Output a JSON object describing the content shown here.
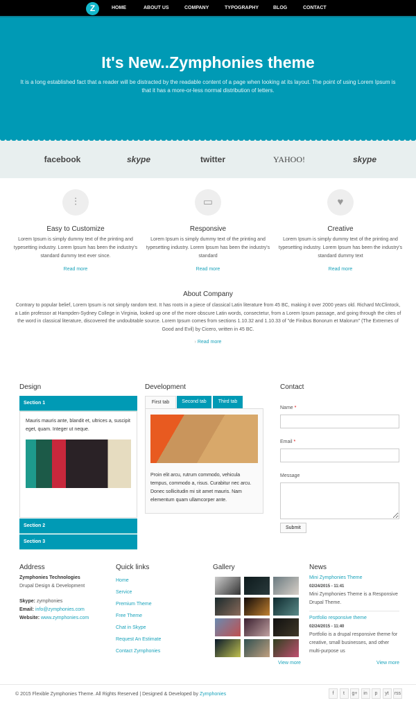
{
  "nav": {
    "logo": "Z",
    "items": [
      "HOME",
      "ABOUT US",
      "COMPANY",
      "TYPOGRAPHY",
      "BLOG",
      "CONTACT"
    ]
  },
  "hero": {
    "title": "It's New..Zymphonies theme",
    "text": "It is a long established fact that a reader will be distracted by the readable content of a page when looking at its layout. The point of using Lorem Ipsum is that it has a more-or-less normal distribution of letters."
  },
  "brands": [
    "facebook",
    "skype",
    "twitter",
    "YAHOO!",
    "skype"
  ],
  "features": [
    {
      "icon": "sliders-icon",
      "title": "Easy to Customize",
      "text": "Lorem Ipsum is simply dummy text of the printing and typesetting industry. Lorem Ipsum has been the industry's standard dummy text ever since.",
      "link": "Read more"
    },
    {
      "icon": "monitor-icon",
      "title": "Responsive",
      "text": "Lorem Ipsum is simply dummy text of the printing and typesetting industry. Lorem Ipsum has been the industry's standard",
      "link": "Read more"
    },
    {
      "icon": "heart-icon",
      "title": "Creative",
      "text": "Lorem Ipsum is simply dummy text of the printing and typesetting industry. Lorem Ipsum has been the industry's standard dummy text",
      "link": "Read more"
    }
  ],
  "about": {
    "title": "About Company",
    "text": "Contrary to popular belief, Lorem Ipsum is not simply random text. It has roots in a piece of classical Latin literature from 45 BC, making it over 2000 years old. Richard McClintock, a Latin professor at Hampden-Sydney College in Virginia, looked up one of the more obscure Latin words, consectetur, from a Lorem Ipsum passage, and going through the cites of the word in classical literature, discovered the undoubtable source. Lorem Ipsum comes from sections 1.10.32 and 1.10.33 of \"de Finibus Bonorum et Malorum\" (The Extremes of Good and Evil) by Cicero, written in 45 BC.",
    "link": "Read more"
  },
  "design": {
    "title": "Design",
    "sections": [
      "Section 1",
      "Section 2",
      "Section 3"
    ],
    "text": "Mauris mauris ante, blandit et, ultrices a, suscipit eget, quam. Integer ut neque."
  },
  "development": {
    "title": "Development",
    "tabs": [
      "First tab",
      "Second tab",
      "Third tab"
    ],
    "text": "Proin elit arcu, rutrum commodo, vehicula tempus, commodo a, risus. Curabitur nec arcu. Donec sollicitudin mi sit amet mauris. Nam elementum quam ullamcorper ante."
  },
  "contact": {
    "title": "Contact",
    "name_label": "Name",
    "email_label": "Email",
    "message_label": "Message",
    "required": "*",
    "name_value": "",
    "email_value": "",
    "message_value": "",
    "submit": "Submit"
  },
  "footer": {
    "address": {
      "title": "Address",
      "company": "Zymphonies Technologies",
      "tagline": "Drupal Design & Development",
      "skype_label": "Skype:",
      "skype": "zymphonies",
      "email_label": "Email:",
      "email": "info@zymphonies.com",
      "website_label": "Website:",
      "website": "www.zymphonies.com"
    },
    "quick_links": {
      "title": "Quick links",
      "items": [
        "Home",
        "Service",
        "Premium Theme",
        "Free Theme",
        "Chat in Skype",
        "Request An Estimate",
        "Contact Zymphonies"
      ]
    },
    "gallery": {
      "title": "Gallery",
      "view_more": "View more"
    },
    "news": {
      "title": "News",
      "items": [
        {
          "title": "Mini Zymphonies Theme",
          "date": "02/24/2015 - 11:41",
          "text": "Mini Zymphonies Theme is a Responsive Drupal Theme."
        },
        {
          "title": "Portfolio responsive theme",
          "date": "02/24/2015 - 11:40",
          "text": "Portfolio is a drupal responsive theme for creative, small businesses, and other multi-purpose us"
        }
      ],
      "view_more": "View more"
    }
  },
  "bottom": {
    "copyright": "© 2015 Flexible Zymphonies Theme. All Rights Reserved | Designed & Developed by",
    "author": "Zymphonies",
    "social": [
      "f",
      "t",
      "g+",
      "in",
      "p",
      "yt",
      "rss"
    ]
  },
  "colors": {
    "accent": "#009ab5",
    "nav": "#000000",
    "band": "#e8efef"
  }
}
